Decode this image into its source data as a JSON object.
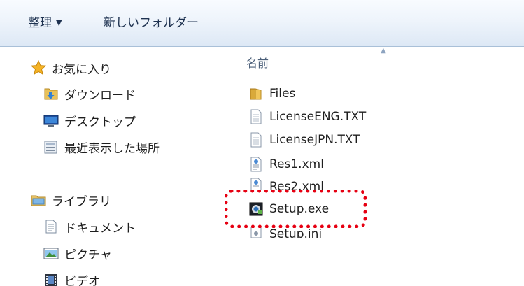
{
  "toolbar": {
    "organize_label": "整理",
    "new_folder_label": "新しいフォルダー"
  },
  "nav": {
    "favorites": {
      "label": "お気に入り",
      "icon": "star-icon",
      "items": [
        {
          "label": "ダウンロード",
          "icon": "downloads-folder-icon"
        },
        {
          "label": "デスクトップ",
          "icon": "desktop-icon"
        },
        {
          "label": "最近表示した場所",
          "icon": "recent-places-icon"
        }
      ]
    },
    "libraries": {
      "label": "ライブラリ",
      "icon": "library-icon",
      "items": [
        {
          "label": "ドキュメント",
          "icon": "documents-icon"
        },
        {
          "label": "ピクチャ",
          "icon": "pictures-icon"
        },
        {
          "label": "ビデオ",
          "icon": "videos-icon"
        }
      ]
    }
  },
  "file_list": {
    "column_header": "名前",
    "files": [
      {
        "name": "Files",
        "icon": "folder-icon"
      },
      {
        "name": "LicenseENG.TXT",
        "icon": "text-file-icon"
      },
      {
        "name": "LicenseJPN.TXT",
        "icon": "text-file-icon"
      },
      {
        "name": "Res1.xml",
        "icon": "xml-file-icon"
      },
      {
        "name": "Res2.xml",
        "icon": "xml-file-icon"
      },
      {
        "name": "Setup.exe",
        "icon": "setup-exe-icon"
      },
      {
        "name": "Setup.ini",
        "icon": "settings-file-icon"
      }
    ]
  },
  "colors": {
    "highlight": "#e60012",
    "toolbar_text": "#1e3250"
  }
}
